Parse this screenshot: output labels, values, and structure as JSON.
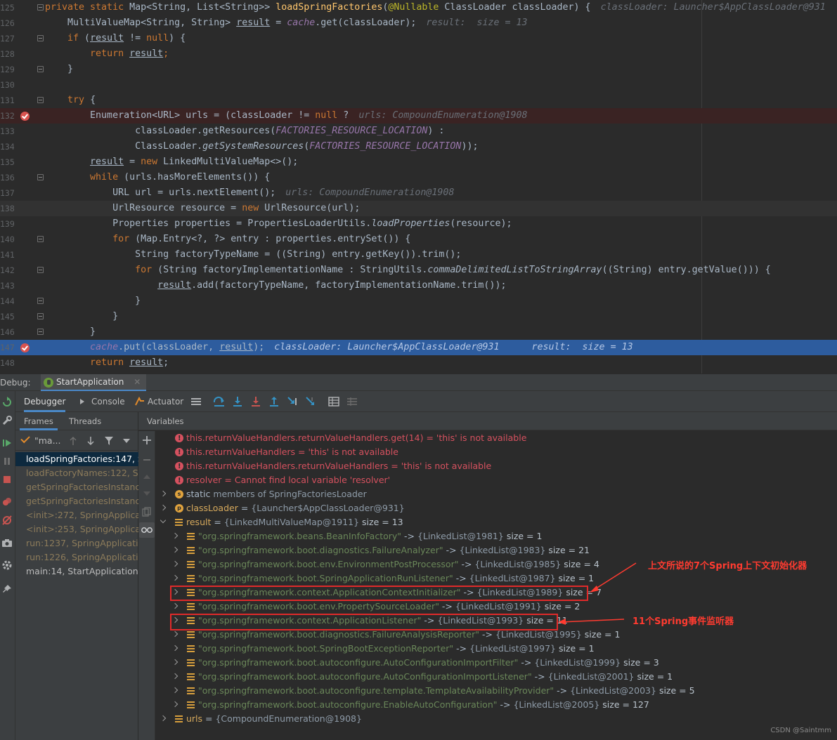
{
  "editor": {
    "lines": [
      {
        "num": "125",
        "kind": "normal",
        "fold": true,
        "parts": [
          {
            "t": "private static ",
            "c": "kw"
          },
          {
            "t": "Map<String, List<String>> "
          },
          {
            "t": "loadSpringFactories",
            "c": "fn"
          },
          {
            "t": "("
          },
          {
            "t": "@Nullable",
            "c": "an"
          },
          {
            "t": " ClassLoader classLoader) {"
          },
          {
            "t": "classLoader: Launcher$AppClassLoader@931",
            "c": "inl"
          }
        ]
      },
      {
        "num": "126",
        "kind": "normal",
        "parts": [
          {
            "t": "    MultiValueMap<String, String> "
          },
          {
            "t": "result",
            "c": "ul"
          },
          {
            "t": " = "
          },
          {
            "t": "cache",
            "c": "cn"
          },
          {
            "t": ".get(classLoader);"
          },
          {
            "t": "result: ",
            "c": "inl"
          },
          {
            "t": " size = 13",
            "c": "inl-v"
          }
        ]
      },
      {
        "num": "127",
        "kind": "normal",
        "fold": true,
        "parts": [
          {
            "t": "    "
          },
          {
            "t": "if",
            "c": "kw"
          },
          {
            "t": " ("
          },
          {
            "t": "result",
            "c": "ul"
          },
          {
            "t": " != "
          },
          {
            "t": "null",
            "c": "kw"
          },
          {
            "t": ") {"
          }
        ]
      },
      {
        "num": "128",
        "kind": "normal",
        "parts": [
          {
            "t": "        "
          },
          {
            "t": "return ",
            "c": "kw"
          },
          {
            "t": "result",
            "c": "ul"
          },
          {
            "t": ";",
            "c": "kw"
          }
        ]
      },
      {
        "num": "129",
        "kind": "normal",
        "fold": true,
        "parts": [
          {
            "t": "    }"
          }
        ]
      },
      {
        "num": "130",
        "kind": "normal",
        "parts": []
      },
      {
        "num": "131",
        "kind": "normal",
        "fold": true,
        "parts": [
          {
            "t": "    "
          },
          {
            "t": "try",
            "c": "kw"
          },
          {
            "t": " {"
          }
        ]
      },
      {
        "num": "132",
        "kind": "bp",
        "bp": true,
        "parts": [
          {
            "t": "        Enumeration<URL> urls = (classLoader != "
          },
          {
            "t": "null",
            "c": "kw"
          },
          {
            "t": " ?"
          },
          {
            "t": "urls: CompoundEnumeration@1908",
            "c": "inl"
          }
        ]
      },
      {
        "num": "133",
        "kind": "normal",
        "parts": [
          {
            "t": "                classLoader.getResources("
          },
          {
            "t": "FACTORIES_RESOURCE_LOCATION",
            "c": "cn"
          },
          {
            "t": ") :"
          }
        ]
      },
      {
        "num": "134",
        "kind": "normal",
        "parts": [
          {
            "t": "                ClassLoader."
          },
          {
            "t": "getSystemResources",
            "c": "it"
          },
          {
            "t": "("
          },
          {
            "t": "FACTORIES_RESOURCE_LOCATION",
            "c": "cn"
          },
          {
            "t": "));"
          }
        ]
      },
      {
        "num": "135",
        "kind": "normal",
        "parts": [
          {
            "t": "        "
          },
          {
            "t": "result",
            "c": "ul"
          },
          {
            "t": " = "
          },
          {
            "t": "new",
            "c": "kw"
          },
          {
            "t": " LinkedMultiValueMap<>();"
          }
        ]
      },
      {
        "num": "136",
        "kind": "normal",
        "fold": true,
        "parts": [
          {
            "t": "        "
          },
          {
            "t": "while",
            "c": "kw"
          },
          {
            "t": " (urls.hasMoreElements()) {"
          }
        ]
      },
      {
        "num": "137",
        "kind": "normal",
        "parts": [
          {
            "t": "            URL url = urls.nextElement();"
          },
          {
            "t": "urls: CompoundEnumeration@1908",
            "c": "inl"
          }
        ]
      },
      {
        "num": "138",
        "kind": "cur",
        "parts": [
          {
            "t": "            UrlResource resource = "
          },
          {
            "t": "new",
            "c": "kw"
          },
          {
            "t": " UrlResource(url);"
          }
        ]
      },
      {
        "num": "139",
        "kind": "normal",
        "parts": [
          {
            "t": "            Properties properties = PropertiesLoaderUtils."
          },
          {
            "t": "loadProperties",
            "c": "it"
          },
          {
            "t": "(resource);"
          }
        ]
      },
      {
        "num": "140",
        "kind": "normal",
        "fold": true,
        "parts": [
          {
            "t": "            "
          },
          {
            "t": "for",
            "c": "kw"
          },
          {
            "t": " (Map.Entry<?, ?> entry : properties.entrySet()) {"
          }
        ]
      },
      {
        "num": "141",
        "kind": "normal",
        "parts": [
          {
            "t": "                String factoryTypeName = ((String) entry.getKey()).trim();"
          }
        ]
      },
      {
        "num": "142",
        "kind": "normal",
        "fold": true,
        "parts": [
          {
            "t": "                "
          },
          {
            "t": "for",
            "c": "kw"
          },
          {
            "t": " (String factoryImplementationName : StringUtils."
          },
          {
            "t": "commaDelimitedListToStringArray",
            "c": "it"
          },
          {
            "t": "((String) entry.getValue())) {"
          }
        ]
      },
      {
        "num": "143",
        "kind": "normal",
        "parts": [
          {
            "t": "                    "
          },
          {
            "t": "result",
            "c": "ul"
          },
          {
            "t": ".add(factoryTypeName, factoryImplementationName.trim());"
          }
        ]
      },
      {
        "num": "144",
        "kind": "normal",
        "fold": true,
        "parts": [
          {
            "t": "                }"
          }
        ]
      },
      {
        "num": "145",
        "kind": "normal",
        "fold": true,
        "parts": [
          {
            "t": "            }"
          }
        ]
      },
      {
        "num": "146",
        "kind": "normal",
        "fold": true,
        "parts": [
          {
            "t": "        }"
          }
        ]
      },
      {
        "num": "147",
        "kind": "exec",
        "bp": true,
        "parts": [
          {
            "t": "        "
          },
          {
            "t": "cache",
            "c": "cn"
          },
          {
            "t": ".put(classLoader, "
          },
          {
            "t": "result",
            "c": "ul"
          },
          {
            "t": ");"
          },
          {
            "t": "classLoader: Launcher$AppClassLoader@931",
            "c": "inl"
          },
          {
            "t": "    result:  size = 13",
            "c": "inl"
          }
        ]
      },
      {
        "num": "148",
        "kind": "normal",
        "parts": [
          {
            "t": "        "
          },
          {
            "t": "return ",
            "c": "kw"
          },
          {
            "t": "result",
            "c": "ul"
          },
          {
            "t": ";"
          }
        ]
      }
    ]
  },
  "debug": {
    "label": "Debug:",
    "session_tab": "StartApplication",
    "tabs": {
      "debugger": "Debugger",
      "console": "Console",
      "actuator": "Actuator"
    },
    "frames_tab": "Frames",
    "threads_tab": "Threads",
    "thread_name": "\"ma...",
    "variables_tab": "Variables",
    "frames": [
      {
        "text": "loadSpringFactories:147, S",
        "kind": "sel"
      },
      {
        "text": "loadFactoryNames:122, Sp",
        "kind": "lib"
      },
      {
        "text": "getSpringFactoriesInstanc",
        "kind": "lib"
      },
      {
        "text": "getSpringFactoriesInstanc",
        "kind": "lib"
      },
      {
        "text": "<init>:272, SpringApplicat",
        "kind": "lib"
      },
      {
        "text": "<init>:253, SpringApplicat",
        "kind": "lib"
      },
      {
        "text": "run:1237, SpringApplication",
        "kind": "lib"
      },
      {
        "text": "run:1226, SpringApplicatio",
        "kind": "lib"
      },
      {
        "text": "main:14, StartApplication",
        "kind": "norm"
      }
    ]
  },
  "variables": {
    "errors": [
      {
        "name": "this.returnValueHandlers.returnValueHandlers.get(14)",
        "msg": "'this' is not available"
      },
      {
        "name": "this.returnValueHandlers",
        "msg": "'this' is not available"
      },
      {
        "name": "this.returnValueHandlers.returnValueHandlers",
        "msg": "'this' is not available"
      },
      {
        "name": "resolver",
        "msg": "Cannot find local variable 'resolver'"
      }
    ],
    "static_row": {
      "kw": "static",
      "rest": "members of SpringFactoriesLoader"
    },
    "classloader_row": {
      "name": "classLoader",
      "value": "{Launcher$AppClassLoader@931}"
    },
    "result_row": {
      "name": "result",
      "value": "{LinkedMultiValueMap@1911}",
      "size": "size = 13"
    },
    "entries": [
      {
        "key": "\"org.springframework.beans.BeanInfoFactory\"",
        "ref": "{LinkedList@1981}",
        "size": "size = 1"
      },
      {
        "key": "\"org.springframework.boot.diagnostics.FailureAnalyzer\"",
        "ref": "{LinkedList@1983}",
        "size": "size = 21"
      },
      {
        "key": "\"org.springframework.boot.env.EnvironmentPostProcessor\"",
        "ref": "{LinkedList@1985}",
        "size": "size = 4"
      },
      {
        "key": "\"org.springframework.boot.SpringApplicationRunListener\"",
        "ref": "{LinkedList@1987}",
        "size": "size = 1"
      },
      {
        "key": "\"org.springframework.context.ApplicationContextInitializer\"",
        "ref": "{LinkedList@1989}",
        "size": "size = 7"
      },
      {
        "key": "\"org.springframework.boot.env.PropertySourceLoader\"",
        "ref": "{LinkedList@1991}",
        "size": "size = 2"
      },
      {
        "key": "\"org.springframework.context.ApplicationListener\"",
        "ref": "{LinkedList@1993}",
        "size": "size = 11"
      },
      {
        "key": "\"org.springframework.boot.diagnostics.FailureAnalysisReporter\"",
        "ref": "{LinkedList@1995}",
        "size": "size = 1"
      },
      {
        "key": "\"org.springframework.boot.SpringBootExceptionReporter\"",
        "ref": "{LinkedList@1997}",
        "size": "size = 1"
      },
      {
        "key": "\"org.springframework.boot.autoconfigure.AutoConfigurationImportFilter\"",
        "ref": "{LinkedList@1999}",
        "size": "size = 3"
      },
      {
        "key": "\"org.springframework.boot.autoconfigure.AutoConfigurationImportListener\"",
        "ref": "{LinkedList@2001}",
        "size": "size = 1"
      },
      {
        "key": "\"org.springframework.boot.autoconfigure.template.TemplateAvailabilityProvider\"",
        "ref": "{LinkedList@2003}",
        "size": "size = 5"
      },
      {
        "key": "\"org.springframework.boot.autoconfigure.EnableAutoConfiguration\"",
        "ref": "{LinkedList@2005}",
        "size": "size = 127"
      }
    ],
    "urls_row": {
      "name": "urls",
      "value": "{CompoundEnumeration@1908}"
    }
  },
  "annotations": {
    "initializers": "上文所说的7个Spring上下文初始化器",
    "listeners": "11个Spring事件监听器",
    "color": "#ff3b30"
  },
  "watermark": "CSDN @Saintmm"
}
